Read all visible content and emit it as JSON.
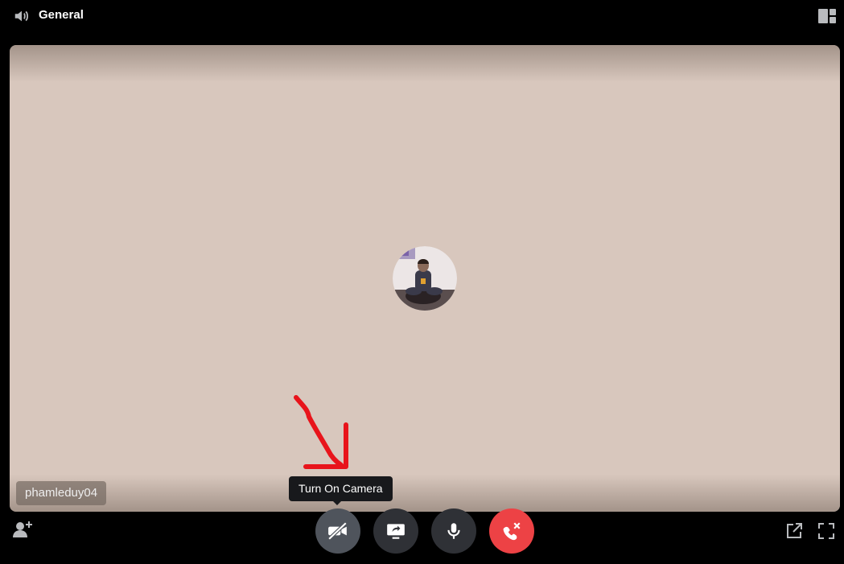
{
  "header": {
    "channel_name": "General",
    "channel_icon": "speaker-icon",
    "layout_icon": "grid-layout-icon"
  },
  "video": {
    "participant_name": "phamleduy04",
    "avatar": "user-avatar",
    "background_color": "#d8c7bd"
  },
  "tooltip": {
    "text": "Turn On Camera"
  },
  "controls": {
    "camera_icon": "camera-off-icon",
    "screen_share_icon": "screen-share-icon",
    "mic_icon": "microphone-icon",
    "leave_icon": "leave-call-icon",
    "leave_color": "#ed4245"
  },
  "footer": {
    "invite_icon": "add-user-icon",
    "popout_icon": "popout-icon",
    "fullscreen_icon": "fullscreen-icon"
  },
  "annotation": {
    "arrow_color": "#e8141b"
  }
}
